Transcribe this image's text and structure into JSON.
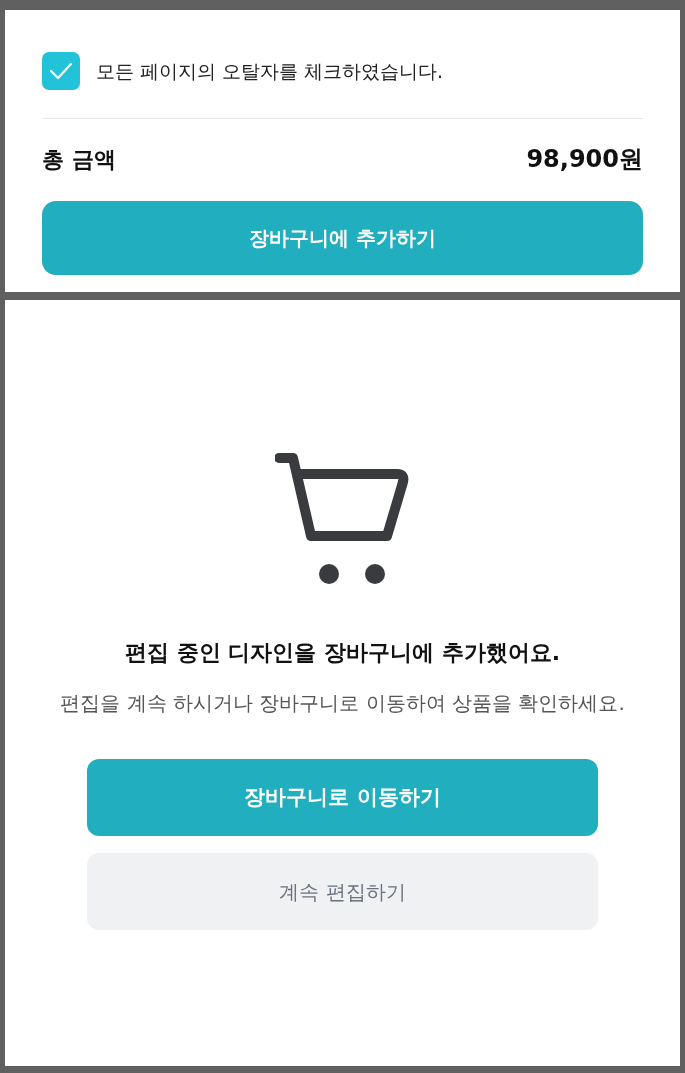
{
  "order_panel": {
    "proofread_check": {
      "label": "모든 페이지의 오탈자를 체크하였습니다.",
      "checked": true
    },
    "total": {
      "label": "총 금액",
      "value": "98,900원"
    },
    "add_to_cart_button": "장바구니에 추가하기"
  },
  "added_dialog": {
    "title": "편집 중인 디자인을 장바구니에 추가했어요.",
    "message": "편집을 계속 하시거나 장바구니로 이동하여 상품을 확인하세요.",
    "primary_button": "장바구니로 이동하기",
    "secondary_button": "계속 편집하기"
  }
}
